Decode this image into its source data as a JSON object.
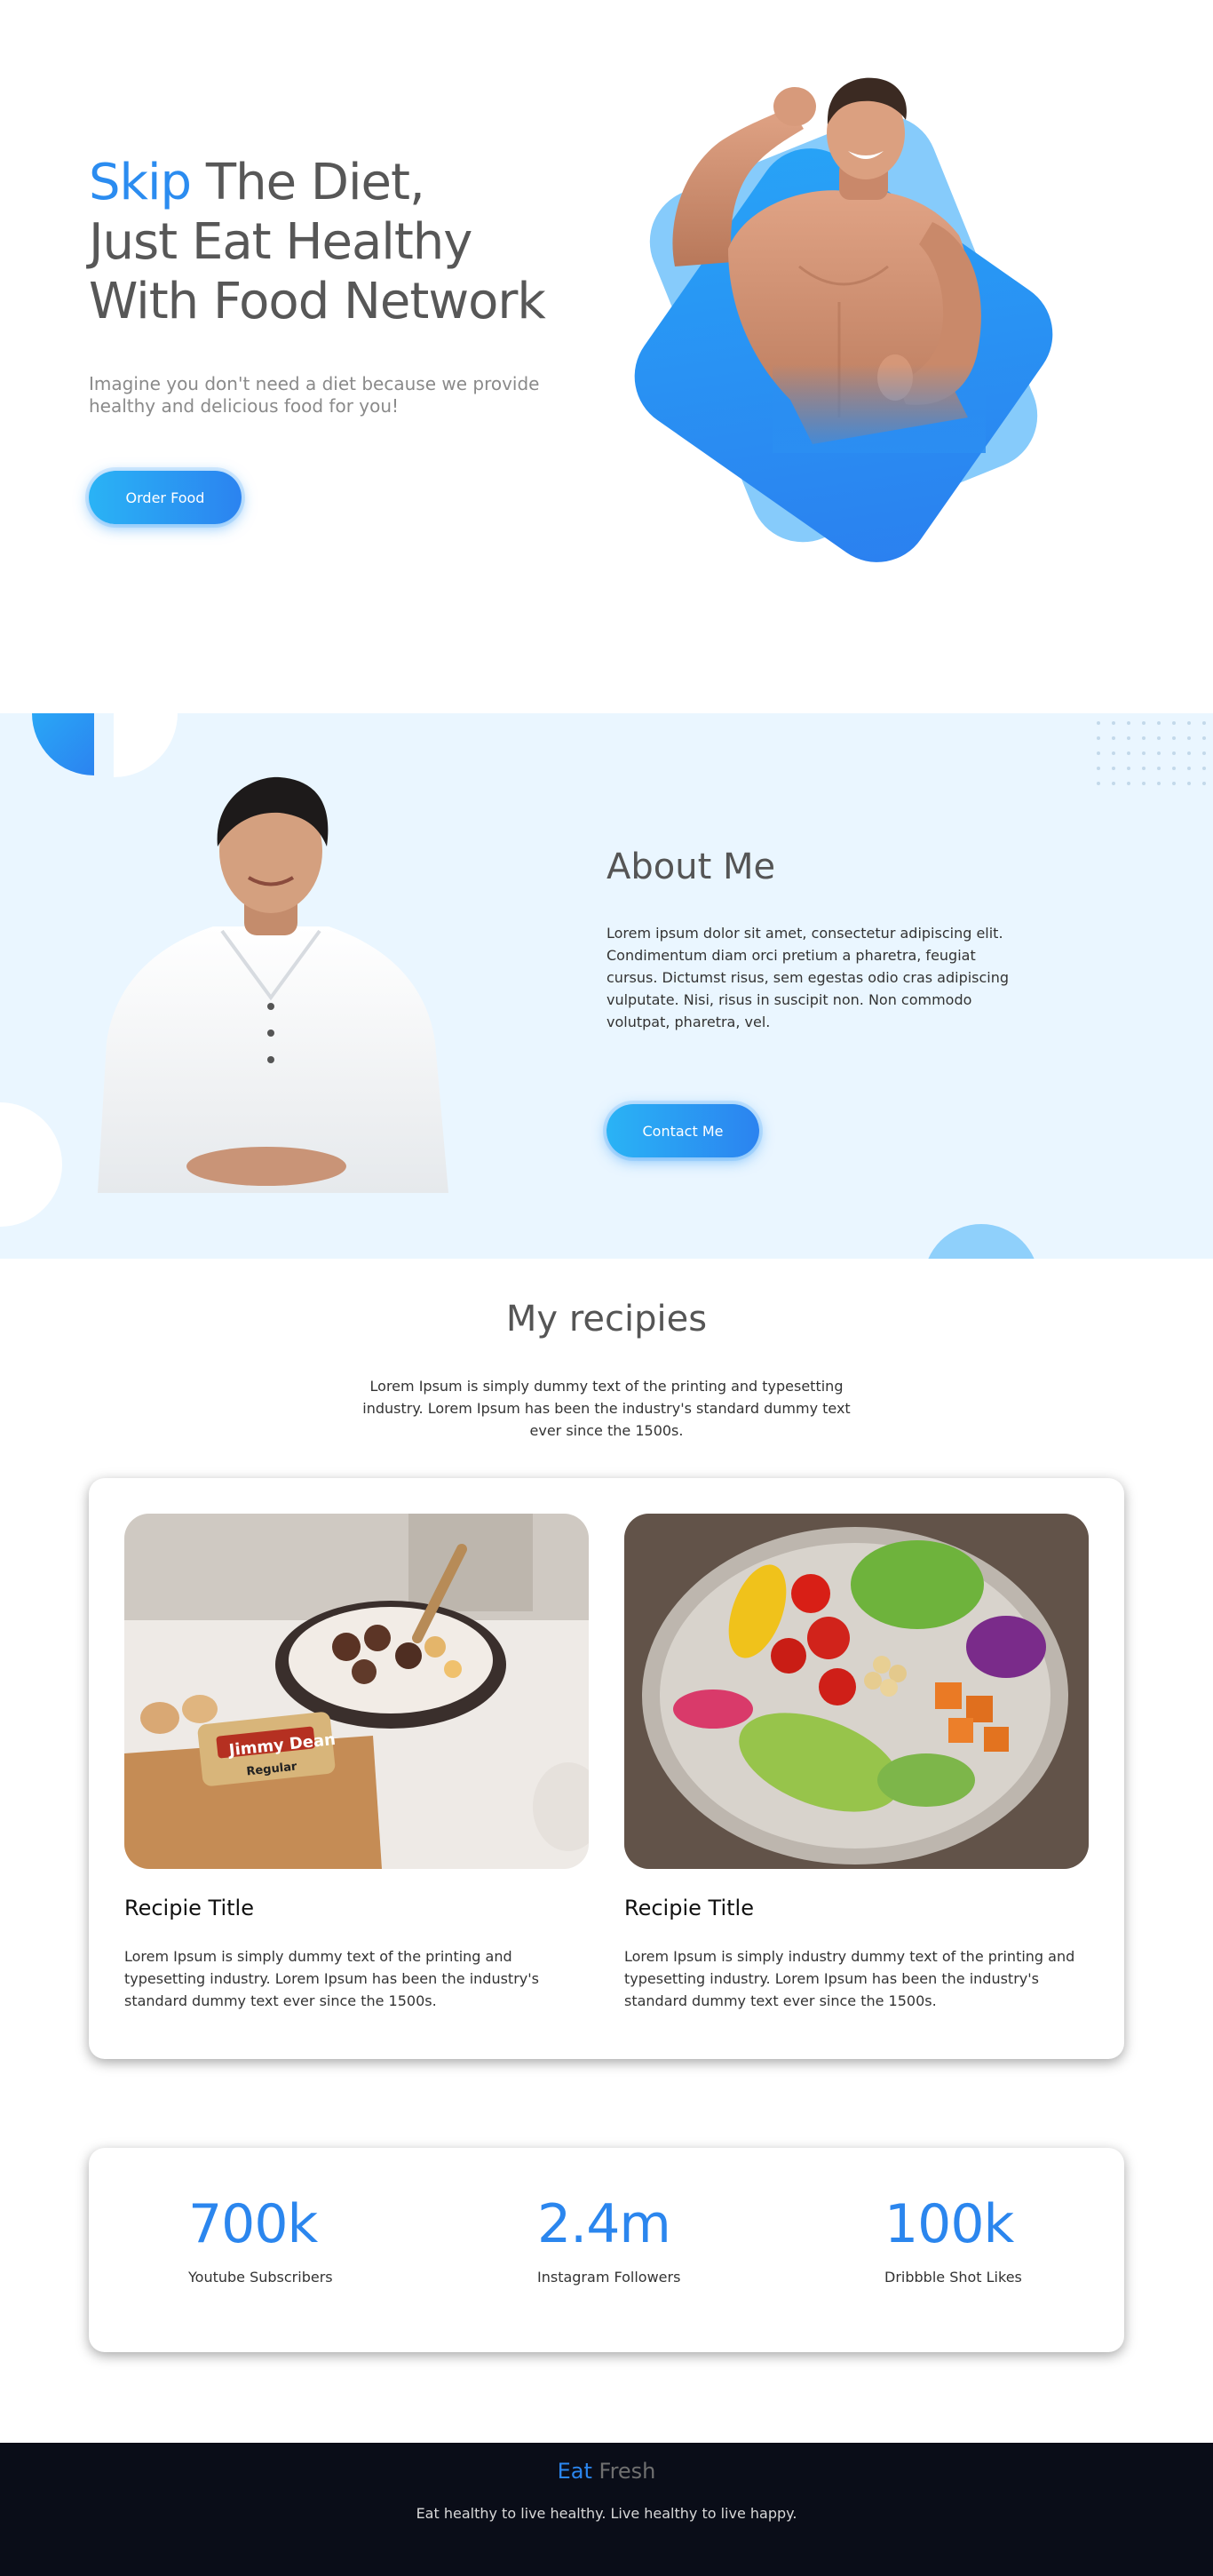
{
  "hero": {
    "title_accent": "Skip",
    "title_rest1": " The Diet,",
    "title_line2": "Just Eat Healthy",
    "title_line3": "With Food Network",
    "subtitle": "Imagine you don't need a diet because we provide healthy and delicious food for you!",
    "order_button": "Order Food"
  },
  "about": {
    "title": "About Me",
    "text": "Lorem ipsum dolor sit amet, consectetur adipiscing elit. Condimentum diam orci pretium a pharetra, feugiat cursus. Dictumst risus, sem egestas odio cras adipiscing vulputate. Nisi, risus in suscipit non. Non commodo volutpat, pharetra, vel.",
    "contact_button": "Contact Me"
  },
  "recipes": {
    "title": "My recipies",
    "description": "Lorem Ipsum is simply dummy text of the printing and typesetting industry. Lorem Ipsum has been the industry's standard dummy text ever since the 1500s.",
    "items": [
      {
        "title": "Recipie Title",
        "text": "Lorem Ipsum is simply dummy text of the printing and typesetting industry. Lorem Ipsum has been the industry's standard dummy text ever since the 1500s.",
        "image": "cooking-pan-sausage-photo",
        "package_label": "Jimmy Dean",
        "package_sublabel": "Regular"
      },
      {
        "title": "Recipie Title",
        "text": "Lorem Ipsum is simply industry dummy text of the printing and typesetting industry. Lorem Ipsum has been the industry's standard dummy text ever since the 1500s.",
        "image": "salad-bowl-photo"
      }
    ]
  },
  "stats": [
    {
      "value": "700k",
      "label": "Youtube Subscribers"
    },
    {
      "value": "2.4m",
      "label": "Instagram Followers"
    },
    {
      "value": "100k",
      "label": "Dribbble Shot Likes"
    }
  ],
  "footer": {
    "logo_eat": "Eat",
    "logo_fresh": " Fresh",
    "tagline": "Eat healthy to live healthy. Live healthy to live happy."
  },
  "colors": {
    "accent": "#2b86ee",
    "about_bg": "#eaf6ff",
    "footer_bg": "#0a0d18"
  }
}
